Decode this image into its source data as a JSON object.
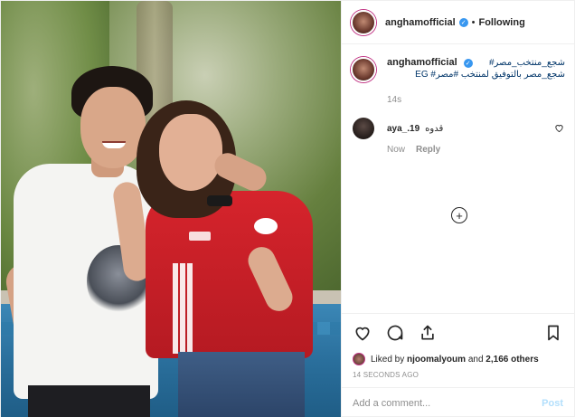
{
  "header": {
    "username": "anghamofficial",
    "verified_mark": "✓",
    "separator": "•",
    "following": "Following"
  },
  "caption": {
    "username": "anghamofficial",
    "line1": "شجع_منتخب_مصر#",
    "line2": "شجع_مصر بالتوفيق لمنتخب #مصر# EG",
    "time": "14s"
  },
  "comment": {
    "username": "aya_.19",
    "text": "قدوه",
    "time": "Now",
    "reply": "Reply"
  },
  "more_comments": "+",
  "likes": {
    "prefix": "Liked by",
    "user": "njoomalyoum",
    "and": "and",
    "others": "2,166 others"
  },
  "timestamp": "14 SECONDS AGO",
  "add_comment": {
    "placeholder": "Add a comment...",
    "post_label": "Post"
  },
  "icons": [
    "heart-icon",
    "comment-icon",
    "share-icon",
    "bookmark-icon",
    "verified-icon",
    "plus-circle-icon"
  ],
  "colors": {
    "link": "#003569",
    "verified": "#3897f0",
    "muted": "#8e8e8e",
    "post_disabled": "#b2dffc"
  }
}
